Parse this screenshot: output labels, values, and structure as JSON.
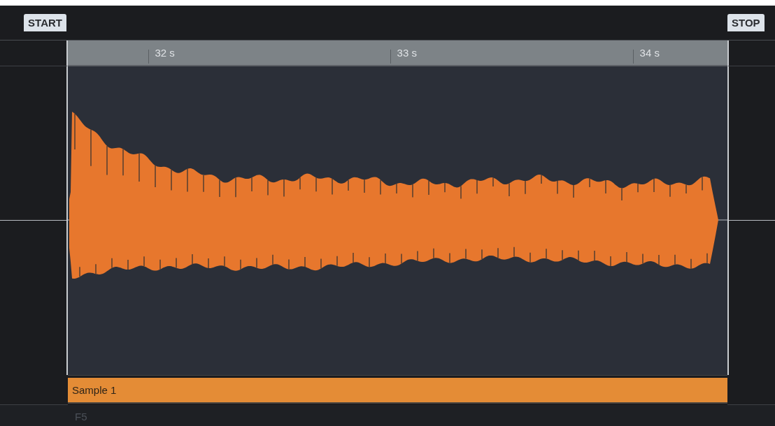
{
  "markers": {
    "start": "START",
    "stop": "STOP"
  },
  "ruler": {
    "ticks": [
      {
        "label": "32 s"
      },
      {
        "label": "33 s"
      },
      {
        "label": "34 s"
      }
    ]
  },
  "region": {
    "label": "Sample 1"
  },
  "footer": {
    "note": "F5"
  }
}
